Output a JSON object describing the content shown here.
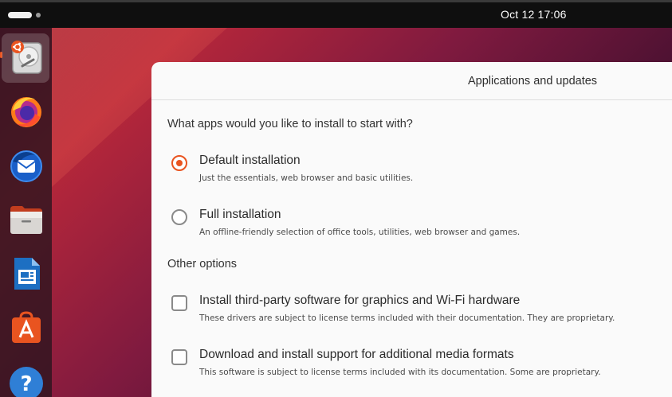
{
  "topbar": {
    "clock": "Oct 12  17:06"
  },
  "dock": {
    "items": [
      {
        "icon": "installer-disk-icon",
        "active": true
      },
      {
        "icon": "firefox-icon"
      },
      {
        "icon": "thunderbird-icon"
      },
      {
        "icon": "files-icon"
      },
      {
        "icon": "libreoffice-writer-icon"
      },
      {
        "icon": "app-center-icon"
      },
      {
        "icon": "help-icon"
      }
    ]
  },
  "window": {
    "title": "Applications and updates",
    "question": "What apps would you like to install to start with?",
    "install_options": [
      {
        "title": "Default installation",
        "description": "Just the essentials, web browser and basic utilities.",
        "selected": true
      },
      {
        "title": "Full installation",
        "description": "An offline-friendly selection of office tools, utilities, web browser and games.",
        "selected": false
      }
    ],
    "other_label": "Other options",
    "other_options": [
      {
        "title": "Install third-party software for graphics and Wi-Fi hardware",
        "description": "These drivers are subject to license terms included with their documentation. They are proprietary.",
        "checked": false
      },
      {
        "title": "Download and install support for additional media formats",
        "description": "This software is subject to license terms included with its documentation. Some are proprietary.",
        "checked": false
      }
    ]
  },
  "colors": {
    "accent": "#e95420",
    "topbar": "#0f0f0f",
    "window_bg": "#fafafa"
  }
}
